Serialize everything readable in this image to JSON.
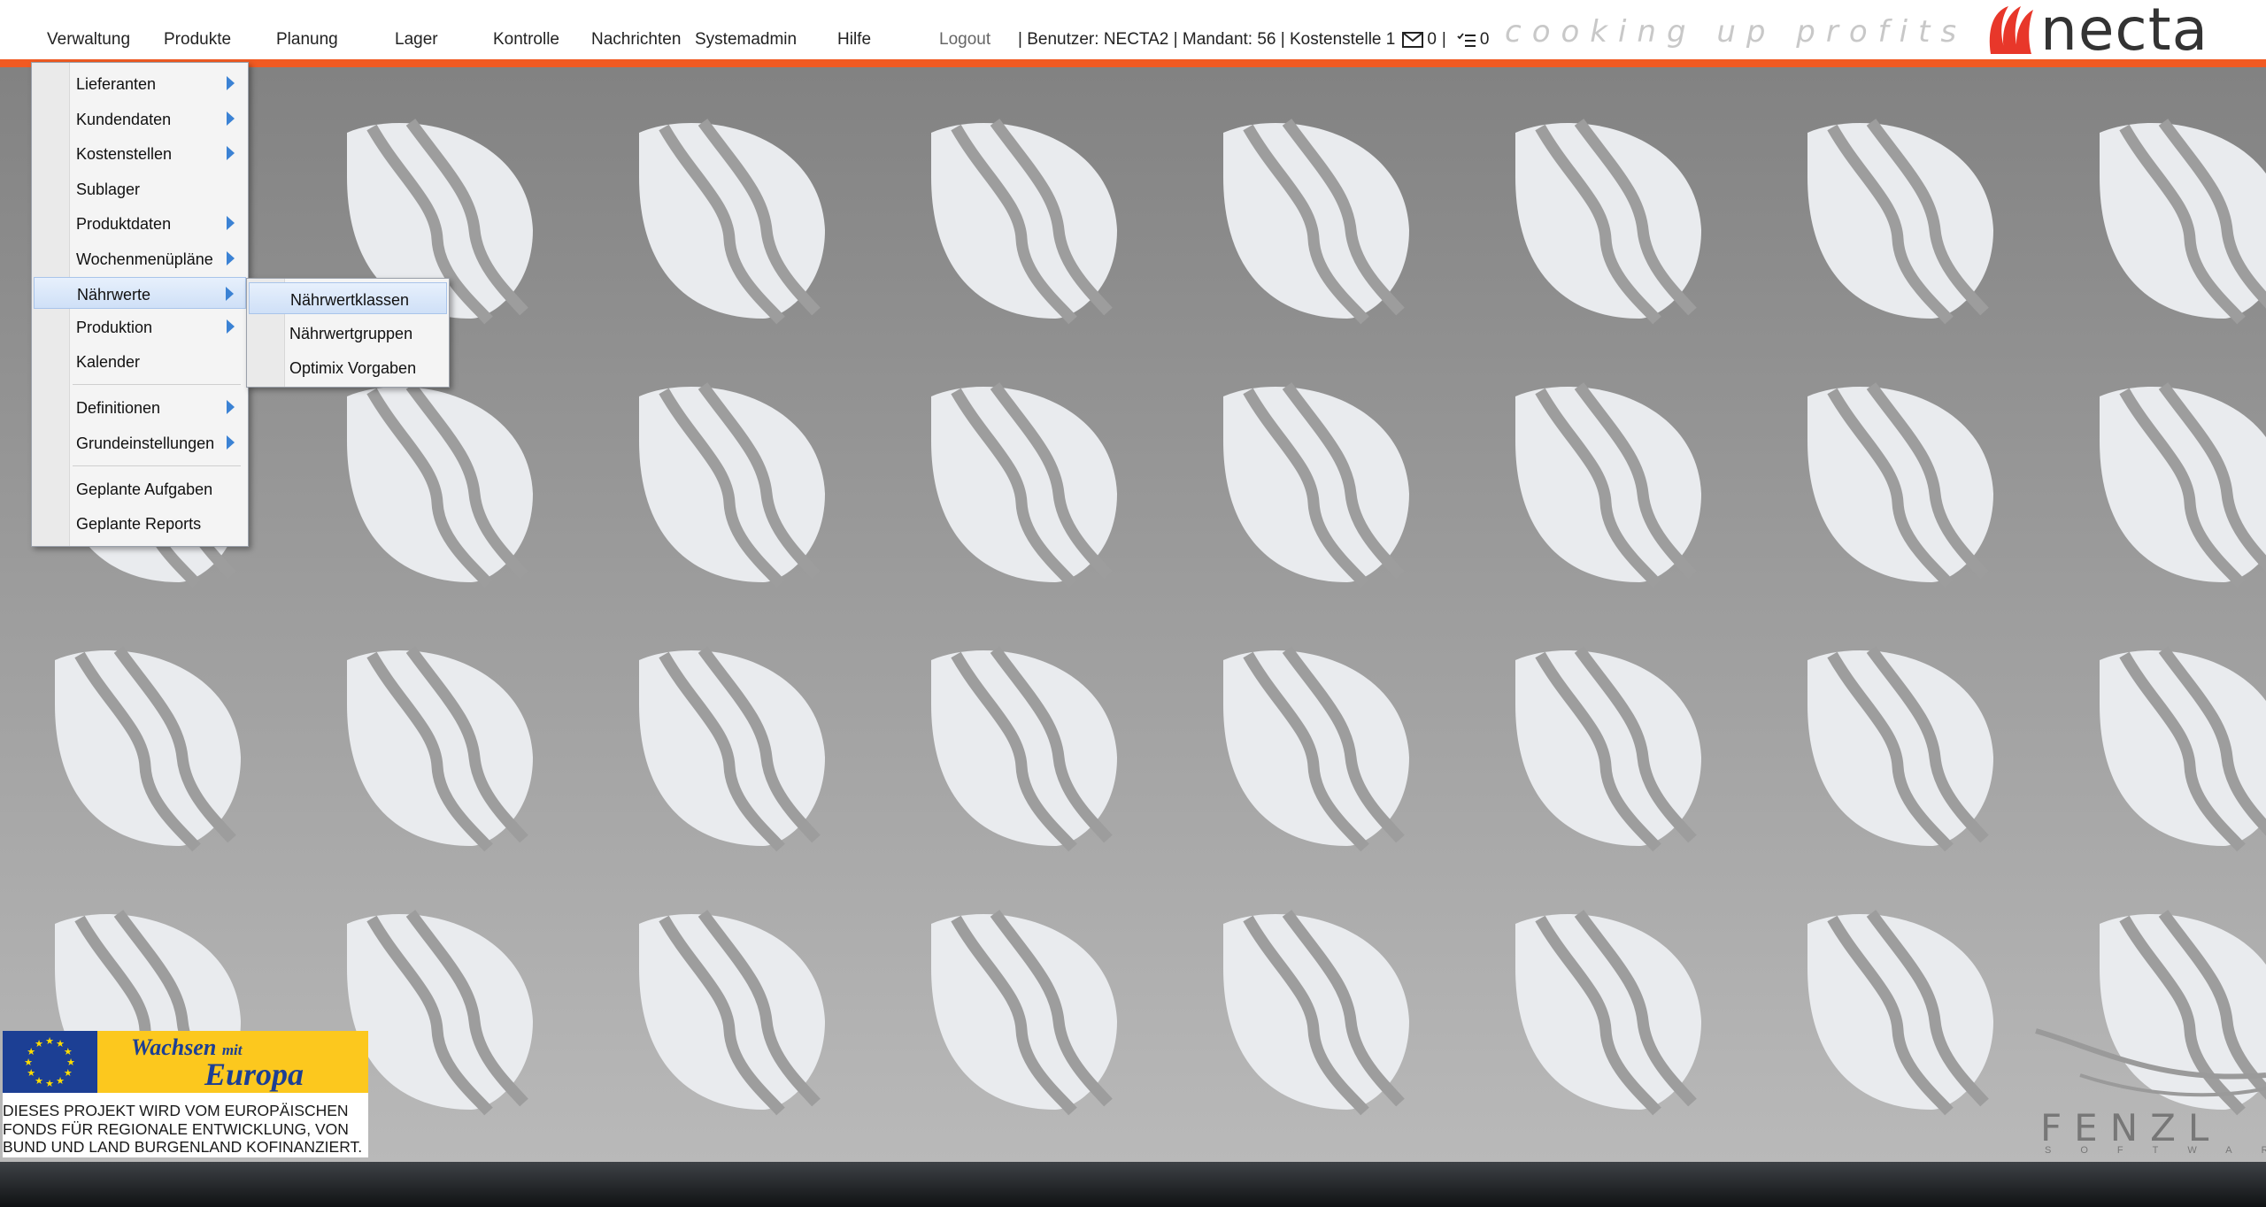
{
  "topnav": {
    "items": [
      {
        "label": "Verwaltung"
      },
      {
        "label": "Produkte"
      },
      {
        "label": "Planung"
      },
      {
        "label": "Lager"
      },
      {
        "label": "Kontrolle"
      },
      {
        "label": "Nachrichten"
      },
      {
        "label": "Systemadmin"
      },
      {
        "label": "Hilfe"
      }
    ],
    "logout": "Logout"
  },
  "status": {
    "user_text": "| Benutzer: NECTA2 | Mandant: 56 | Kostenstelle 1",
    "messages_count": "0",
    "separator": "|",
    "tasks_count": "0",
    "mail_icon": "mail-icon",
    "tasks_icon": "task-list-icon"
  },
  "branding": {
    "tagline": "cooking up profits",
    "logo_text": "necta",
    "brand_color": "#f15a22",
    "watermark": "FENZL",
    "watermark_sub": "SOFTWARE"
  },
  "verwaltung_menu": {
    "items": [
      {
        "label": "Lieferanten",
        "submenu": true
      },
      {
        "label": "Kundendaten",
        "submenu": true
      },
      {
        "label": "Kostenstellen",
        "submenu": true
      },
      {
        "label": "Sublager",
        "submenu": false
      },
      {
        "label": "Produktdaten",
        "submenu": true
      },
      {
        "label": "Wochenmenüpläne",
        "submenu": true
      },
      {
        "label": "Nährwerte",
        "submenu": true,
        "highlighted": true
      },
      {
        "label": "Produktion",
        "submenu": true
      },
      {
        "label": "Kalender",
        "submenu": false
      },
      {
        "label": "Definitionen",
        "submenu": true
      },
      {
        "label": "Grundeinstellungen",
        "submenu": true
      },
      {
        "label": "Geplante Aufgaben",
        "submenu": false
      },
      {
        "label": "Geplante Reports",
        "submenu": false
      }
    ]
  },
  "naehrwerte_submenu": {
    "items": [
      {
        "label": "Nährwertklassen",
        "highlighted": true
      },
      {
        "label": "Nährwertgruppen"
      },
      {
        "label": "Optimix Vorgaben"
      }
    ]
  },
  "eu_banner": {
    "line1_a": "Wachsen",
    "line1_b": "mit",
    "line2": "Europa",
    "text_1": "DIESES PROJEKT WIRD  VOM EUROPÄISCHEN",
    "text_2": "FONDS FÜR REGIONALE ENTWICKLUNG,  VON",
    "text_3": "BUND UND LAND BURGENLAND KOFINANZIERT."
  }
}
